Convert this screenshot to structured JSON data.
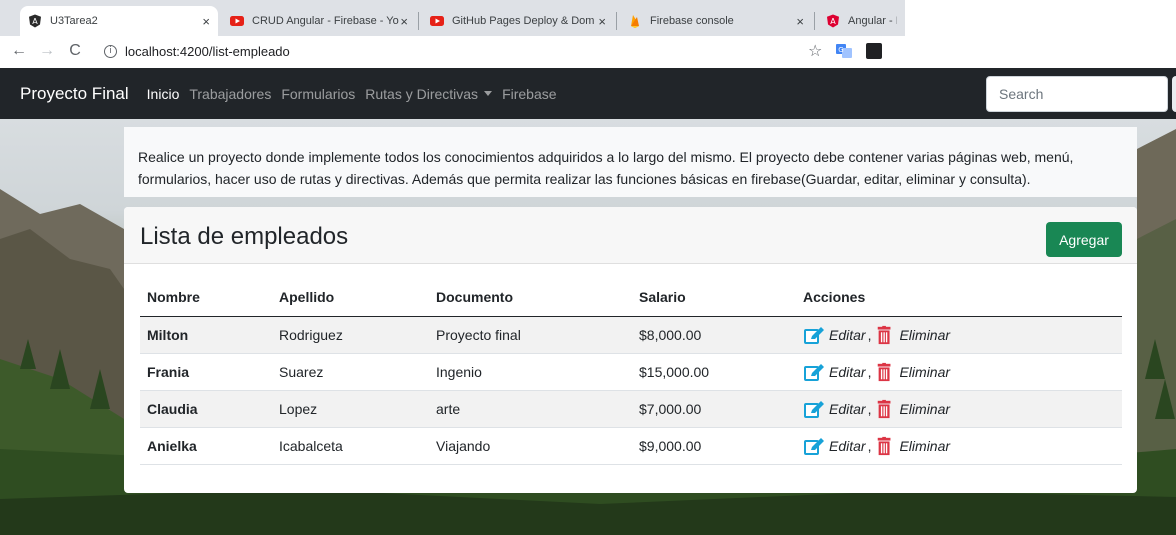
{
  "browser": {
    "tabs": [
      {
        "title": "U3Tarea2",
        "active": true
      },
      {
        "title": "CRUD Angular - Firebase - Yo",
        "active": false
      },
      {
        "title": "GitHub Pages Deploy & Dom",
        "active": false
      },
      {
        "title": "Firebase console",
        "active": false
      },
      {
        "title": "Angular - Ir",
        "active": false
      }
    ],
    "url": "localhost:4200/list-empleado"
  },
  "navbar": {
    "brand": "Proyecto Final",
    "links": [
      "Inicio",
      "Trabajadores",
      "Formularios",
      "Rutas y Directivas",
      "Firebase"
    ],
    "search_placeholder": "Search"
  },
  "intro": {
    "text": "Realice un proyecto donde implemente todos los conocimientos adquiridos a lo largo del mismo. El proyecto debe contener varias páginas web, menú, formularios, hacer uso de rutas y directivas. Además que permita realizar las funciones básicas en firebase(Guardar, editar, eliminar y consulta)."
  },
  "list": {
    "title": "Lista de empleados",
    "add_label": "Agregar",
    "columns": [
      "Nombre",
      "Apellido",
      "Documento",
      "Salario",
      "Acciones"
    ],
    "rows": [
      {
        "nombre": "Milton",
        "apellido": "Rodriguez",
        "documento": "Proyecto final",
        "salario": "$8,000.00"
      },
      {
        "nombre": "Frania",
        "apellido": "Suarez",
        "documento": "Ingenio",
        "salario": "$15,000.00"
      },
      {
        "nombre": "Claudia",
        "apellido": "Lopez",
        "documento": "arte",
        "salario": "$7,000.00"
      },
      {
        "nombre": "Anielka",
        "apellido": "Icabalceta",
        "documento": "Viajando",
        "salario": "$9,000.00"
      }
    ],
    "edit_label": "Editar",
    "delete_label": "Eliminar",
    "separator": ","
  },
  "colors": {
    "navbar_bg": "#212529",
    "success": "#198754",
    "edit_icon": "#17a2d8",
    "delete_icon": "#dc3545"
  }
}
